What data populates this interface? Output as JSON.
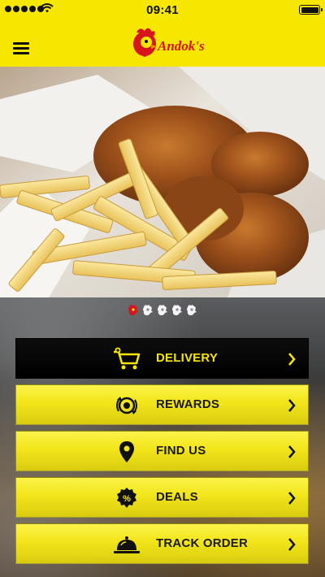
{
  "status_bar": {
    "time": "09:41",
    "signal_icon": "signal-dots-icon",
    "wifi_icon": "wifi-icon",
    "battery_icon": "battery-icon"
  },
  "header": {
    "menu_icon": "hamburger-menu-icon",
    "logo_text": "Andok's",
    "logo_icon": "rooster-logo"
  },
  "hero": {
    "image": "fried-chicken-and-fries-photo"
  },
  "carousel": {
    "total": 5,
    "active": 0,
    "icon": "rooster-head-icon"
  },
  "colors": {
    "brand_yellow": "#f6e600",
    "active_bg": "#000000",
    "active_text": "#f6e600",
    "dark_text": "#1a1a1a"
  },
  "menu": [
    {
      "label": "DELIVERY",
      "icon": "delivery-cart-icon",
      "active": true
    },
    {
      "label": "REWARDS",
      "icon": "rewards-icon",
      "active": false
    },
    {
      "label": "FIND US",
      "icon": "location-pin-icon",
      "active": false
    },
    {
      "label": "DEALS",
      "icon": "deals-percent-icon",
      "active": false
    },
    {
      "label": "TRACK ORDER",
      "icon": "food-cloche-icon",
      "active": false
    }
  ]
}
